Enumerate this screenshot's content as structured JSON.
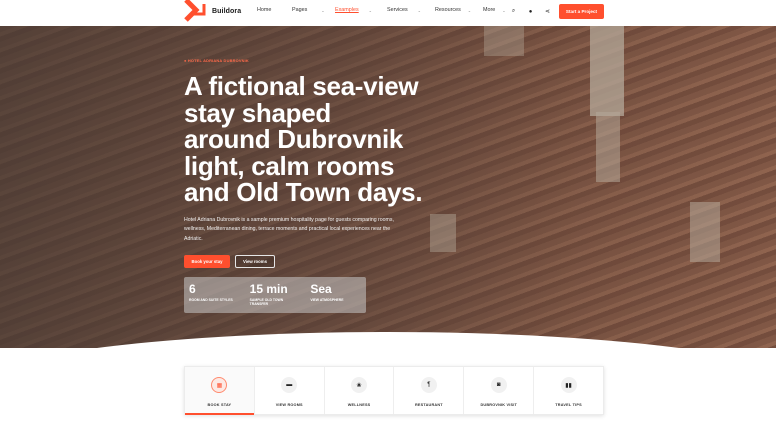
{
  "brand": {
    "name": "Buildora",
    "accent": "#ff4f2e"
  },
  "nav": {
    "items": [
      {
        "label": "Home",
        "chevron": false,
        "active": false
      },
      {
        "label": "Pages",
        "chevron": true,
        "active": false
      },
      {
        "label": "Examples",
        "chevron": true,
        "active": true
      },
      {
        "label": "Services",
        "chevron": true,
        "active": false
      },
      {
        "label": "Resources",
        "chevron": true,
        "active": false
      },
      {
        "label": "More",
        "chevron": true,
        "active": false
      }
    ],
    "icons": [
      "search-icon",
      "user-icon",
      "share-icon"
    ],
    "cta_label": "Start a Project"
  },
  "hero": {
    "eyebrow": "● HOTEL ADRIANA DUBROVNIK",
    "headline": "A fictional sea-view stay shaped around Dubrovnik light, calm rooms and Old Town days.",
    "description": "Hotel Adriana Dubrovnik is a sample premium hospitality page for guests comparing rooms, wellness, Mediterranean dining, terrace moments and practical local experiences near the Adriatic.",
    "primary_button": "Book your stay",
    "secondary_button": "View rooms",
    "stats": [
      {
        "value": "6",
        "label": "ROOM AND SUITE STYLES"
      },
      {
        "value": "15 min",
        "label": "SAMPLE OLD TOWN TRANSFER"
      },
      {
        "value": "Sea",
        "label": "VIEW ATMOSPHERE"
      }
    ]
  },
  "tabs": [
    {
      "label": "BOOK STAY",
      "icon": "calendar-icon",
      "active": true
    },
    {
      "label": "VIEW ROOMS",
      "icon": "bed-icon",
      "active": false
    },
    {
      "label": "WELLNESS",
      "icon": "lotus-icon",
      "active": false
    },
    {
      "label": "RESTAURANT",
      "icon": "cutlery-icon",
      "active": false
    },
    {
      "label": "DUBROVNIK VISIT",
      "icon": "camera-icon",
      "active": false
    },
    {
      "label": "TRAVEL TIPS",
      "icon": "book-icon",
      "active": false
    }
  ]
}
